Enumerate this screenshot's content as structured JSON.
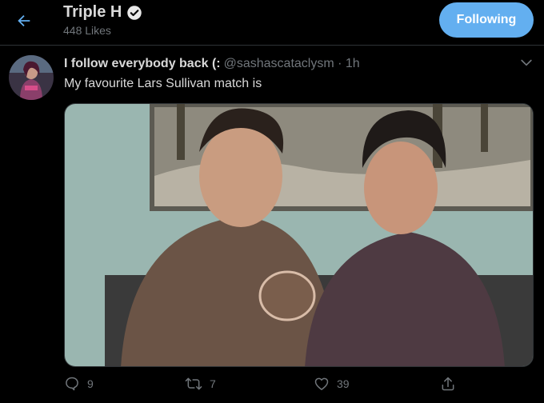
{
  "header": {
    "title": "Triple H",
    "likes_count": "448 Likes",
    "following_label": "Following",
    "back_icon": "arrow-left-icon",
    "verified_icon": "verified-badge-icon"
  },
  "tweet": {
    "author_name": "I follow everybody back (:",
    "handle": "@sashascataclysm",
    "separator": "·",
    "time": "1h",
    "text": "My favourite Lars Sullivan match is",
    "more_icon": "chevron-down-icon"
  },
  "actions": {
    "reply_count": "9",
    "retweet_count": "7",
    "like_count": "39",
    "share_icon": "share-icon"
  },
  "colors": {
    "accent": "#63aff0",
    "background": "#000000",
    "secondary_text": "#71767b",
    "primary_text": "#d9d9d9"
  }
}
